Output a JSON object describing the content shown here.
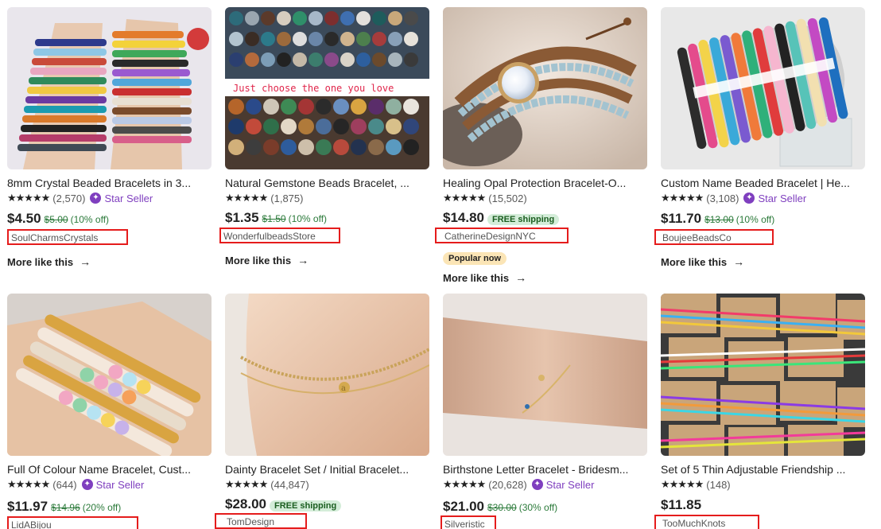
{
  "listings": [
    {
      "title": "8mm Crystal Beaded Bracelets in 3...",
      "stars": "★★★★★",
      "reviews": "(2,570)",
      "star_seller": "Star Seller",
      "price": "$4.50",
      "original_price": "$5.00",
      "discount": "(10% off)",
      "shop": "SoulCharmsCrystals",
      "more": "More like this"
    },
    {
      "title": "Natural Gemstone Beads Bracelet, ...",
      "stars": "★★★★★",
      "reviews": "(1,875)",
      "price": "$1.35",
      "original_price": "$1.50",
      "discount": "(10% off)",
      "shop": "WonderfulbeadsStore",
      "more": "More like this",
      "image_caption": "Just choose the one you love"
    },
    {
      "title": "Healing Opal Protection Bracelet-O...",
      "stars": "★★★★★",
      "reviews": "(15,502)",
      "price": "$14.80",
      "free_shipping": "FREE shipping",
      "shop": "CatherineDesignNYC",
      "badge": "Popular now",
      "more": "More like this"
    },
    {
      "title": "Custom Name Beaded Bracelet | He...",
      "stars": "★★★★★",
      "reviews": "(3,108)",
      "star_seller": "Star Seller",
      "price": "$11.70",
      "original_price": "$13.00",
      "discount": "(10% off)",
      "shop": "BoujeeBeadsCo",
      "more": "More like this"
    },
    {
      "title": "Full Of Colour Name Bracelet, Cust...",
      "stars": "★★★★★",
      "reviews": "(644)",
      "star_seller": "Star Seller",
      "price": "$11.97",
      "original_price": "$14.96",
      "discount": "(20% off)",
      "shop": "LidABijou"
    },
    {
      "title": "Dainty Bracelet Set / Initial Bracelet...",
      "stars": "★★★★★",
      "reviews": "(44,847)",
      "price": "$28.00",
      "free_shipping": "FREE shipping",
      "shop": "TomDesign"
    },
    {
      "title": "Birthstone Letter Bracelet - Bridesm...",
      "stars": "★★★★★",
      "reviews": "(20,628)",
      "star_seller": "Star Seller",
      "price": "$21.00",
      "original_price": "$30.00",
      "discount": "(30% off)",
      "shop": "Silveristic"
    },
    {
      "title": "Set of 5 Thin Adjustable Friendship ...",
      "stars": "★★★★★",
      "reviews": "(148)",
      "price": "$11.85",
      "shop": "TooMuchKnots"
    }
  ],
  "icons": {
    "arrow": "arrow-right-icon",
    "star_seller": "star-seller-badge-icon"
  }
}
